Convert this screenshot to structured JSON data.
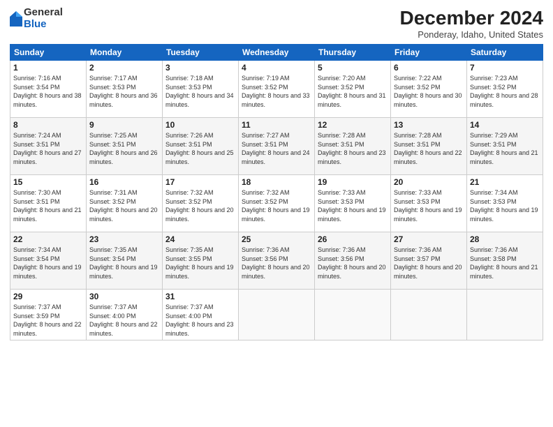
{
  "header": {
    "logo_general": "General",
    "logo_blue": "Blue",
    "title": "December 2024",
    "location": "Ponderay, Idaho, United States"
  },
  "columns": [
    "Sunday",
    "Monday",
    "Tuesday",
    "Wednesday",
    "Thursday",
    "Friday",
    "Saturday"
  ],
  "weeks": [
    [
      {
        "day": "1",
        "sunrise": "Sunrise: 7:16 AM",
        "sunset": "Sunset: 3:54 PM",
        "daylight": "Daylight: 8 hours and 38 minutes."
      },
      {
        "day": "2",
        "sunrise": "Sunrise: 7:17 AM",
        "sunset": "Sunset: 3:53 PM",
        "daylight": "Daylight: 8 hours and 36 minutes."
      },
      {
        "day": "3",
        "sunrise": "Sunrise: 7:18 AM",
        "sunset": "Sunset: 3:53 PM",
        "daylight": "Daylight: 8 hours and 34 minutes."
      },
      {
        "day": "4",
        "sunrise": "Sunrise: 7:19 AM",
        "sunset": "Sunset: 3:52 PM",
        "daylight": "Daylight: 8 hours and 33 minutes."
      },
      {
        "day": "5",
        "sunrise": "Sunrise: 7:20 AM",
        "sunset": "Sunset: 3:52 PM",
        "daylight": "Daylight: 8 hours and 31 minutes."
      },
      {
        "day": "6",
        "sunrise": "Sunrise: 7:22 AM",
        "sunset": "Sunset: 3:52 PM",
        "daylight": "Daylight: 8 hours and 30 minutes."
      },
      {
        "day": "7",
        "sunrise": "Sunrise: 7:23 AM",
        "sunset": "Sunset: 3:52 PM",
        "daylight": "Daylight: 8 hours and 28 minutes."
      }
    ],
    [
      {
        "day": "8",
        "sunrise": "Sunrise: 7:24 AM",
        "sunset": "Sunset: 3:51 PM",
        "daylight": "Daylight: 8 hours and 27 minutes."
      },
      {
        "day": "9",
        "sunrise": "Sunrise: 7:25 AM",
        "sunset": "Sunset: 3:51 PM",
        "daylight": "Daylight: 8 hours and 26 minutes."
      },
      {
        "day": "10",
        "sunrise": "Sunrise: 7:26 AM",
        "sunset": "Sunset: 3:51 PM",
        "daylight": "Daylight: 8 hours and 25 minutes."
      },
      {
        "day": "11",
        "sunrise": "Sunrise: 7:27 AM",
        "sunset": "Sunset: 3:51 PM",
        "daylight": "Daylight: 8 hours and 24 minutes."
      },
      {
        "day": "12",
        "sunrise": "Sunrise: 7:28 AM",
        "sunset": "Sunset: 3:51 PM",
        "daylight": "Daylight: 8 hours and 23 minutes."
      },
      {
        "day": "13",
        "sunrise": "Sunrise: 7:28 AM",
        "sunset": "Sunset: 3:51 PM",
        "daylight": "Daylight: 8 hours and 22 minutes."
      },
      {
        "day": "14",
        "sunrise": "Sunrise: 7:29 AM",
        "sunset": "Sunset: 3:51 PM",
        "daylight": "Daylight: 8 hours and 21 minutes."
      }
    ],
    [
      {
        "day": "15",
        "sunrise": "Sunrise: 7:30 AM",
        "sunset": "Sunset: 3:51 PM",
        "daylight": "Daylight: 8 hours and 21 minutes."
      },
      {
        "day": "16",
        "sunrise": "Sunrise: 7:31 AM",
        "sunset": "Sunset: 3:52 PM",
        "daylight": "Daylight: 8 hours and 20 minutes."
      },
      {
        "day": "17",
        "sunrise": "Sunrise: 7:32 AM",
        "sunset": "Sunset: 3:52 PM",
        "daylight": "Daylight: 8 hours and 20 minutes."
      },
      {
        "day": "18",
        "sunrise": "Sunrise: 7:32 AM",
        "sunset": "Sunset: 3:52 PM",
        "daylight": "Daylight: 8 hours and 19 minutes."
      },
      {
        "day": "19",
        "sunrise": "Sunrise: 7:33 AM",
        "sunset": "Sunset: 3:53 PM",
        "daylight": "Daylight: 8 hours and 19 minutes."
      },
      {
        "day": "20",
        "sunrise": "Sunrise: 7:33 AM",
        "sunset": "Sunset: 3:53 PM",
        "daylight": "Daylight: 8 hours and 19 minutes."
      },
      {
        "day": "21",
        "sunrise": "Sunrise: 7:34 AM",
        "sunset": "Sunset: 3:53 PM",
        "daylight": "Daylight: 8 hours and 19 minutes."
      }
    ],
    [
      {
        "day": "22",
        "sunrise": "Sunrise: 7:34 AM",
        "sunset": "Sunset: 3:54 PM",
        "daylight": "Daylight: 8 hours and 19 minutes."
      },
      {
        "day": "23",
        "sunrise": "Sunrise: 7:35 AM",
        "sunset": "Sunset: 3:54 PM",
        "daylight": "Daylight: 8 hours and 19 minutes."
      },
      {
        "day": "24",
        "sunrise": "Sunrise: 7:35 AM",
        "sunset": "Sunset: 3:55 PM",
        "daylight": "Daylight: 8 hours and 19 minutes."
      },
      {
        "day": "25",
        "sunrise": "Sunrise: 7:36 AM",
        "sunset": "Sunset: 3:56 PM",
        "daylight": "Daylight: 8 hours and 20 minutes."
      },
      {
        "day": "26",
        "sunrise": "Sunrise: 7:36 AM",
        "sunset": "Sunset: 3:56 PM",
        "daylight": "Daylight: 8 hours and 20 minutes."
      },
      {
        "day": "27",
        "sunrise": "Sunrise: 7:36 AM",
        "sunset": "Sunset: 3:57 PM",
        "daylight": "Daylight: 8 hours and 20 minutes."
      },
      {
        "day": "28",
        "sunrise": "Sunrise: 7:36 AM",
        "sunset": "Sunset: 3:58 PM",
        "daylight": "Daylight: 8 hours and 21 minutes."
      }
    ],
    [
      {
        "day": "29",
        "sunrise": "Sunrise: 7:37 AM",
        "sunset": "Sunset: 3:59 PM",
        "daylight": "Daylight: 8 hours and 22 minutes."
      },
      {
        "day": "30",
        "sunrise": "Sunrise: 7:37 AM",
        "sunset": "Sunset: 4:00 PM",
        "daylight": "Daylight: 8 hours and 22 minutes."
      },
      {
        "day": "31",
        "sunrise": "Sunrise: 7:37 AM",
        "sunset": "Sunset: 4:00 PM",
        "daylight": "Daylight: 8 hours and 23 minutes."
      },
      null,
      null,
      null,
      null
    ]
  ]
}
